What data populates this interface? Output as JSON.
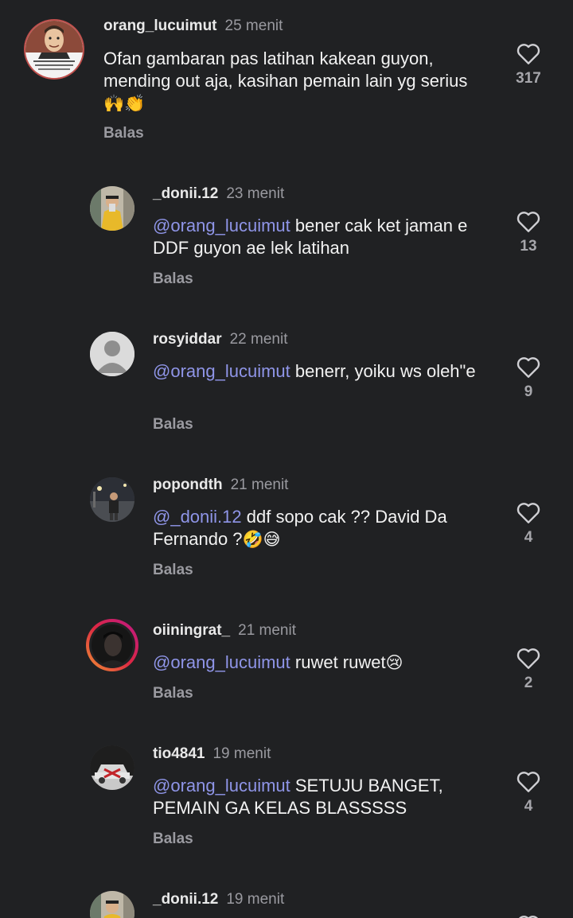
{
  "comments": [
    {
      "username": "orang_lucuimut",
      "time": "25 menit",
      "mention": "",
      "text": "Ofan gambaran pas latihan kakean guyon, mending out aja, kasihan pemain lain yg serius",
      "emoji": "🙌👏",
      "reply": "Balas",
      "likes": "317",
      "avatar": "mr-bean-quote-avatar",
      "avatar_quote": "\"Bersedih itu hanya buang waktu saja, sedih dikasih untuk cerai yuk.\""
    },
    {
      "username": "_donii.12",
      "time": "23 menit",
      "mention": "@orang_lucuimut",
      "text": " bener cak ket jaman e DDF guyon ae lek latihan",
      "emoji": "",
      "reply": "Balas",
      "likes": "13",
      "avatar": "mirror-selfie-avatar"
    },
    {
      "username": "rosyiddar",
      "time": "22 menit",
      "mention": "@orang_lucuimut",
      "text": " benerr, yoiku ws oleh\"e",
      "emoji": "",
      "reply": "Balas",
      "likes": "9",
      "avatar": "default-person-avatar"
    },
    {
      "username": "popondth",
      "time": "21 menit",
      "mention": "@_donii.12",
      "text": " ddf sopo cak ?? David Da Fernando ?",
      "emoji": "🤣😅",
      "reply": "Balas",
      "likes": "4",
      "avatar": "night-street-avatar"
    },
    {
      "username": "oiiningrat_",
      "time": "21 menit",
      "mention": "@orang_lucuimut",
      "text": " ruwet ruwet",
      "emoji": "😢",
      "reply": "Balas",
      "likes": "2",
      "avatar": "story-ring-avatar"
    },
    {
      "username": "tio4841",
      "time": "19 menit",
      "mention": "@orang_lucuimut",
      "text": " SETUJU BANGET, PEMAIN GA KELAS BLASSSSS",
      "emoji": "",
      "reply": "Balas",
      "likes": "4",
      "avatar": "car-avatar"
    },
    {
      "username": "_donii.12",
      "time": "19 menit",
      "mention": "",
      "text": "",
      "emoji": "",
      "reply": "",
      "likes": "",
      "avatar": "mirror-selfie-avatar"
    }
  ],
  "colors": {
    "background": "#202123",
    "mention": "#8f95e8",
    "muted": "#9a9aa0",
    "story_ring_start": "#f09433",
    "story_ring_end": "#bc1888"
  }
}
